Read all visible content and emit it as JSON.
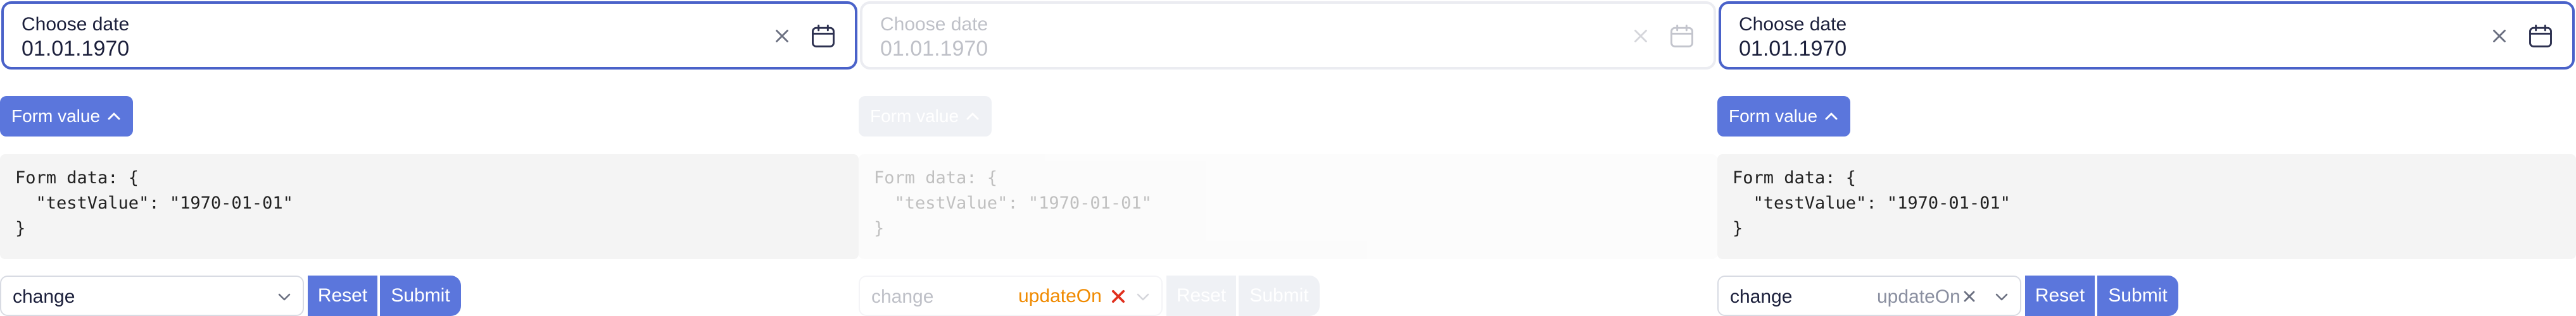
{
  "columns": [
    {
      "date_label": "Choose date",
      "date_value": "01.01.1970",
      "form_value_label": "Form value",
      "code_lines": [
        "Form data: {",
        "  \"testValue\": \"1970-01-01\"",
        "}"
      ],
      "select_value": "change",
      "select_updateon": "",
      "reset_label": "Reset",
      "submit_label": "Submit"
    },
    {
      "date_label": "Choose date",
      "date_value": "01.01.1970",
      "form_value_label": "Form value",
      "code_lines": [
        "Form data: {",
        "  \"testValue\": \"1970-01-01\"",
        "}"
      ],
      "select_value": "change",
      "select_updateon": "",
      "reset_label": "Reset",
      "submit_label": "Submit"
    },
    {
      "date_label": "Choose date",
      "date_value": "01.01.1970",
      "form_value_label": "Form value",
      "code_lines": [
        "Form data: {",
        "  \"testValue\": \"1970-01-01\"",
        "}"
      ],
      "select_value": "change",
      "select_updateon": "updateOn",
      "reset_label": "Reset",
      "submit_label": "Submit"
    }
  ],
  "floating_chip": {
    "label": "updateOn",
    "color": "#f08a00",
    "icon": "close-icon"
  },
  "colors": {
    "accent": "#5b76dc",
    "border_focus": "#4a62c9"
  }
}
